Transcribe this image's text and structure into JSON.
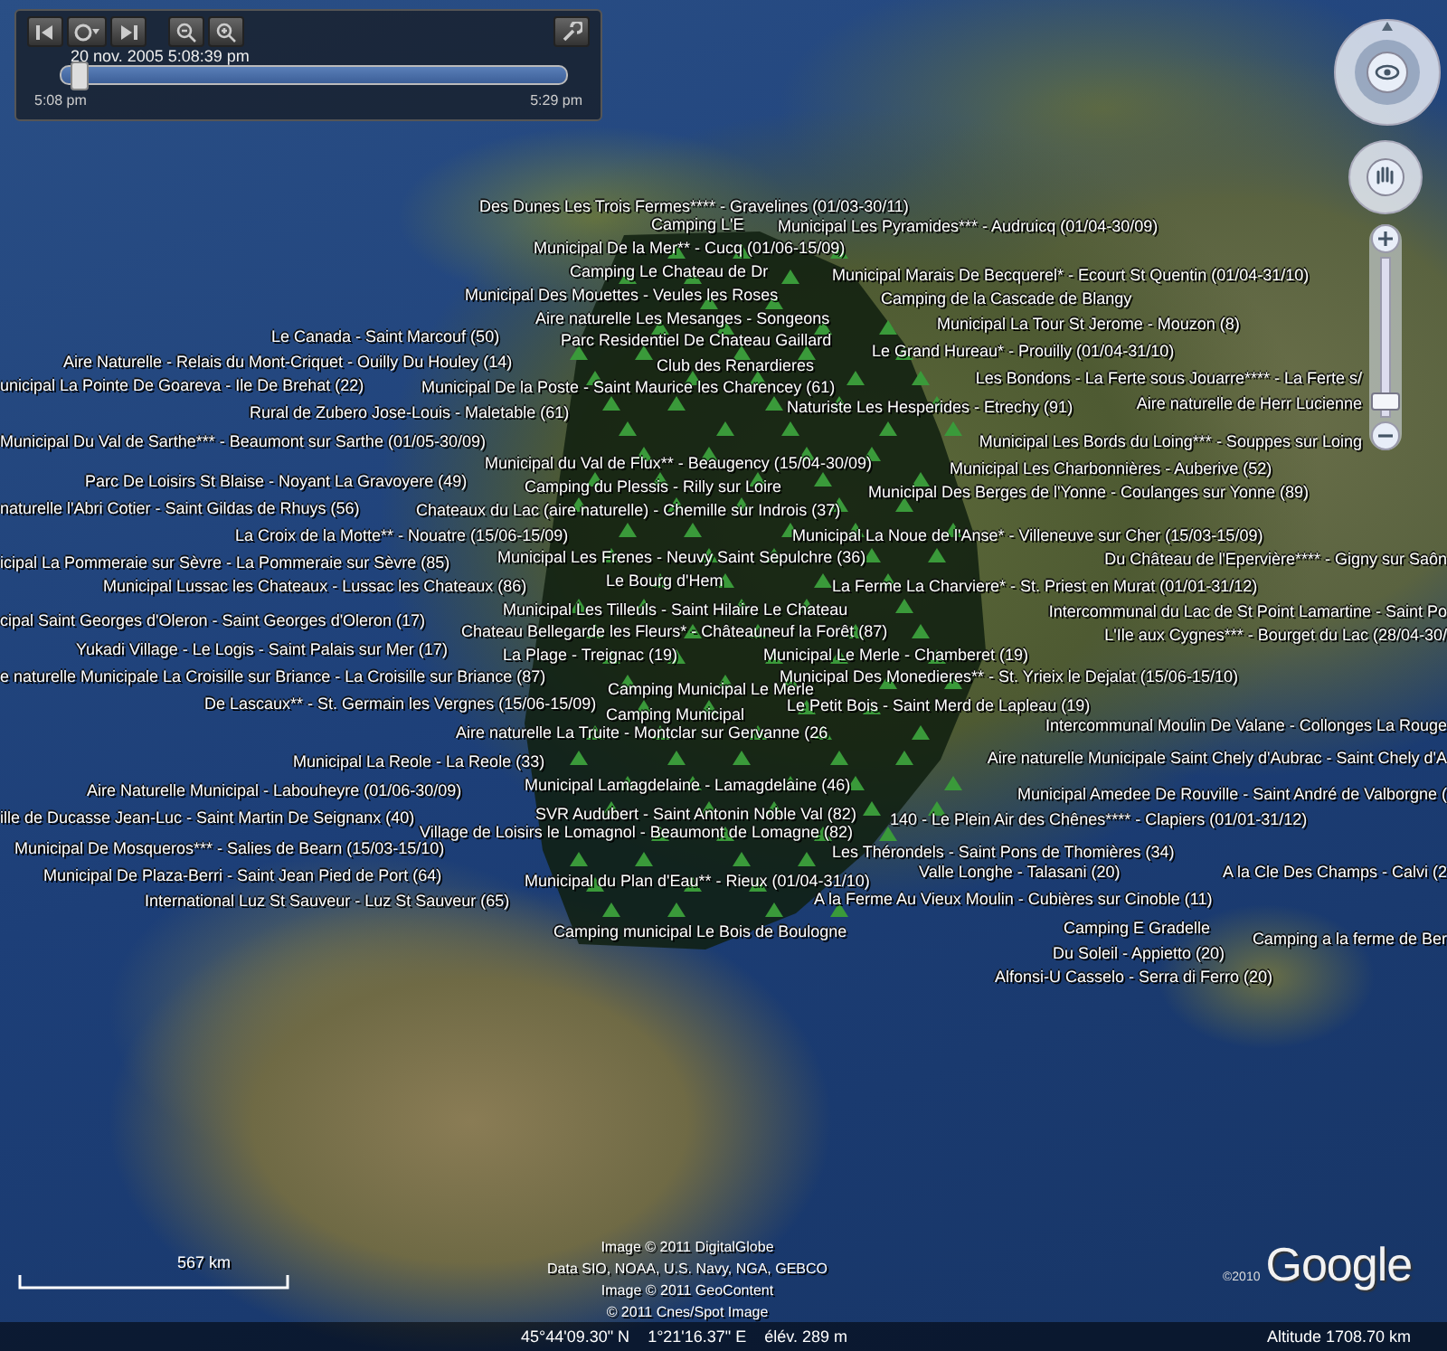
{
  "time_slider": {
    "date_time": "20 nov. 2005  5:08:39 pm",
    "start": "5:08 pm",
    "end": "5:29 pm",
    "level": 0.02
  },
  "zoom_slider": {
    "level": 0.08
  },
  "placemarks": [
    {
      "label": "Des Dunes Les Trois Fermes**** - Gravelines (01/03-30/11)"
    },
    {
      "label": "Camping L'E"
    },
    {
      "label": "Municipal Les Pyramides*** - Audruicq (01/04-30/09)"
    },
    {
      "label": "Municipal De la Mer** - Cucq (01/06-15/09)"
    },
    {
      "label": "Camping Le Chateau de Dr"
    },
    {
      "label": "Municipal Marais De Becquerel* - Ecourt St Quentin (01/04-31/10)"
    },
    {
      "label": "Municipal Des Mouettes - Veules les Roses"
    },
    {
      "label": "Camping de la Cascade de Blangy"
    },
    {
      "label": "Aire naturelle Les Mesanges - Songeons"
    },
    {
      "label": "Municipal La Tour St Jerome - Mouzon (8)"
    },
    {
      "label": "Le Canada - Saint Marcouf (50)"
    },
    {
      "label": "Parc Residentiel De Chateau Gaillard"
    },
    {
      "label": "Le Grand Hureau* - Prouilly (01/04-31/10)"
    },
    {
      "label": "Aire Naturelle - Relais du Mont-Criquet - Ouilly Du Houley (14)"
    },
    {
      "label": "Club des Renardieres"
    },
    {
      "label": "Les Bondons - La Ferte sous Jouarre**** - La Ferte s/"
    },
    {
      "label": "unicipal La Pointe De Goareva - Ile De Brehat (22)"
    },
    {
      "label": "Municipal De la Poste - Saint Maurice les Charencey (61)"
    },
    {
      "label": "Rural de Zubero Jose-Louis - Maletable (61)"
    },
    {
      "label": "Naturiste Les Hesperides - Etrechy (91)"
    },
    {
      "label": "Aire naturelle de Herr Lucienne"
    },
    {
      "label": "Municipal Du Val de Sarthe*** - Beaumont sur Sarthe (01/05-30/09)"
    },
    {
      "label": "Municipal Les Bords du Loing*** - Souppes sur Loing"
    },
    {
      "label": "Municipal du Val de Flux** - Beaugency (15/04-30/09)"
    },
    {
      "label": "Municipal Les Charbonnières - Auberive (52)"
    },
    {
      "label": "Parc De Loisirs St Blaise - Noyant La Gravoyere (49)"
    },
    {
      "label": "Camping du Plessis - Rilly sur Loire"
    },
    {
      "label": "Municipal Des Berges de l'Yonne - Coulanges sur Yonne (89)"
    },
    {
      "label": "naturelle l'Abri Cotier - Saint Gildas de Rhuys (56)"
    },
    {
      "label": "Chateaux du Lac (aire naturelle) - Chemille sur Indrois (37)"
    },
    {
      "label": "La Croix de la Motte** - Nouatre (15/06-15/09)"
    },
    {
      "label": "Municipal La Noue de l'Anse* - Villeneuve sur Cher (15/03-15/09)"
    },
    {
      "label": "icipal La Pommeraie sur Sèvre - La Pommeraie sur Sèvre (85)"
    },
    {
      "label": "Municipal Les Frenes - Neuvy Saint Sepulchre (36)"
    },
    {
      "label": "Du Château de l'Epervière**** - Gigny sur Saôn"
    },
    {
      "label": "Municipal Lussac les Chateaux - Lussac les Chateaux (86)"
    },
    {
      "label": "Le Bourg d'Hem"
    },
    {
      "label": "La Ferme La Charviere* - St. Priest en Murat (01/01-31/12)"
    },
    {
      "label": "cipal Saint Georges d'Oleron - Saint Georges d'Oleron (17)"
    },
    {
      "label": "Municipal Les Tilleuls - Saint Hilaire Le Chateau"
    },
    {
      "label": "Intercommunal du Lac de St Point Lamartine - Saint Po"
    },
    {
      "label": "Chateau Bellegarde les Fleurs* - Châteauneuf la Forêt (87)"
    },
    {
      "label": "L'Ile aux Cygnes*** - Bourget du Lac (28/04-30/"
    },
    {
      "label": "Yukadi Village - Le Logis - Saint Palais sur Mer (17)"
    },
    {
      "label": "La Plage - Treignac (19)"
    },
    {
      "label": "Municipal Le Merle - Chamberet (19)"
    },
    {
      "label": "e naturelle Municipale La Croisille sur Briance - La Croisille sur Briance (87)"
    },
    {
      "label": "Municipal Des Monedieres** - St. Yrieix le Dejalat (15/06-15/10)"
    },
    {
      "label": "Camping Municipal Le Merle"
    },
    {
      "label": "De Lascaux** - St. Germain les Vergnes (15/06-15/09)"
    },
    {
      "label": "Camping Municipal"
    },
    {
      "label": "Le Petit Bois - Saint Merd de Lapleau (19)"
    },
    {
      "label": "Intercommunal Moulin De Valane - Collonges La Rouge"
    },
    {
      "label": "Aire naturelle La Truite - Montclar sur Gervanne (26"
    },
    {
      "label": "Municipal La Reole - La Reole (33)"
    },
    {
      "label": "Aire naturelle Municipale Saint Chely d'Aubrac - Saint Chely d'A"
    },
    {
      "label": "Aire Naturelle Municipal - Labouheyre (01/06-30/09)"
    },
    {
      "label": "Municipal Lamagdelaine - Lamagdelaine (46)"
    },
    {
      "label": "Municipal Amedee De Rouville - Saint André de Valborgne ("
    },
    {
      "label": "ille de Ducasse Jean-Luc - Saint Martin De Seignanx (40)"
    },
    {
      "label": "SVR Audubert - Saint Antonin Noble Val (82)"
    },
    {
      "label": "140 - Le Plein Air des Chênes**** - Clapiers (01/01-31/12)"
    },
    {
      "label": "Village de Loisirs le Lomagnol - Beaumont de Lomagne (82)"
    },
    {
      "label": "Municipal De Mosqueros*** - Salies de Bearn (15/03-15/10)"
    },
    {
      "label": "Les Thérondels - Saint Pons de Thomières (34)"
    },
    {
      "label": "Municipal De Plaza-Berri - Saint Jean Pied de Port (64)"
    },
    {
      "label": "Municipal du Plan d'Eau** - Rieux (01/04-31/10)"
    },
    {
      "label": "Valle Longhe - Talasani (20)"
    },
    {
      "label": "A la Cle Des Champs - Calvi (2"
    },
    {
      "label": "International Luz St Sauveur - Luz St Sauveur (65)"
    },
    {
      "label": "A la Ferme Au Vieux Moulin - Cubières sur Cinoble (11)"
    },
    {
      "label": "Camping municipal Le Bois de Boulogne"
    },
    {
      "label": "Camping E Gradelle"
    },
    {
      "label": "Camping a la ferme de Ber"
    },
    {
      "label": "Du Soleil - Appietto (20)"
    },
    {
      "label": "Alfonsi-U Casselo - Serra di Ferro (20)"
    }
  ],
  "scale": {
    "distance": "567  km"
  },
  "attribution": [
    "Image © 2011 DigitalGlobe",
    "Data SIO, NOAA, U.S. Navy, NGA, GEBCO",
    "Image © 2011 GeoContent",
    "© 2011 Cnes/Spot Image"
  ],
  "logo": {
    "copyright": "©2010",
    "name": "Google"
  },
  "status_bar": {
    "latitude": "45°44'09.30\" N",
    "longitude": "1°21'16.37\" E",
    "elevation": "élév.  289 m",
    "altitude": "Altitude  1708.70 km"
  }
}
